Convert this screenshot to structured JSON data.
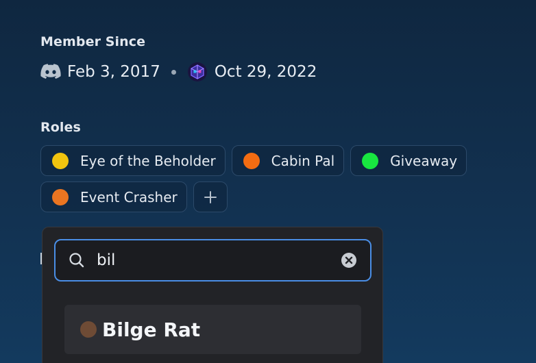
{
  "member_since": {
    "title": "Member Since",
    "discord_date": "Feb 3, 2017",
    "server_date": "Oct 29, 2022",
    "icons": [
      "discord-icon",
      "server-icon"
    ]
  },
  "roles": {
    "title": "Roles",
    "items": [
      {
        "label": "Eye of the Beholder",
        "color": "#f1c40f"
      },
      {
        "label": "Cabin Pal",
        "color": "#f36c12"
      },
      {
        "label": "Giveaway",
        "color": "#18e640"
      },
      {
        "label": "Event Crasher",
        "color": "#ea7521"
      }
    ],
    "add_icon": "plus-icon"
  },
  "role_picker": {
    "search_value": "bil",
    "results": [
      {
        "label": "Bilge Rat",
        "color": "#6e4b35"
      }
    ],
    "accent": "#4a8ee6"
  }
}
